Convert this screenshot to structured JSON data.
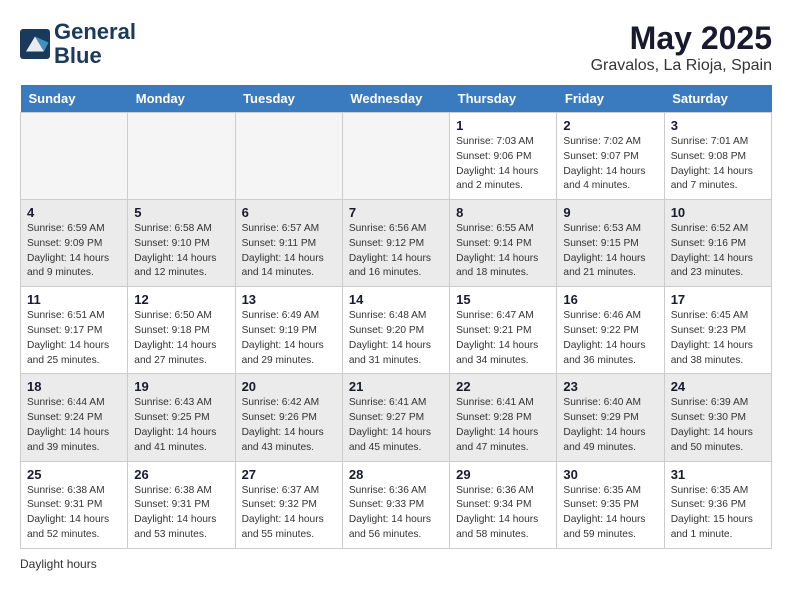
{
  "header": {
    "logo_line1": "General",
    "logo_line2": "Blue",
    "month": "May 2025",
    "location": "Gravalos, La Rioja, Spain"
  },
  "days_of_week": [
    "Sunday",
    "Monday",
    "Tuesday",
    "Wednesday",
    "Thursday",
    "Friday",
    "Saturday"
  ],
  "weeks": [
    [
      {
        "day": "",
        "empty": true
      },
      {
        "day": "",
        "empty": true
      },
      {
        "day": "",
        "empty": true
      },
      {
        "day": "",
        "empty": true
      },
      {
        "day": "1",
        "sunrise": "7:03 AM",
        "sunset": "9:06 PM",
        "daylight": "14 hours and 2 minutes."
      },
      {
        "day": "2",
        "sunrise": "7:02 AM",
        "sunset": "9:07 PM",
        "daylight": "14 hours and 4 minutes."
      },
      {
        "day": "3",
        "sunrise": "7:01 AM",
        "sunset": "9:08 PM",
        "daylight": "14 hours and 7 minutes."
      }
    ],
    [
      {
        "day": "4",
        "sunrise": "6:59 AM",
        "sunset": "9:09 PM",
        "daylight": "14 hours and 9 minutes."
      },
      {
        "day": "5",
        "sunrise": "6:58 AM",
        "sunset": "9:10 PM",
        "daylight": "14 hours and 12 minutes."
      },
      {
        "day": "6",
        "sunrise": "6:57 AM",
        "sunset": "9:11 PM",
        "daylight": "14 hours and 14 minutes."
      },
      {
        "day": "7",
        "sunrise": "6:56 AM",
        "sunset": "9:12 PM",
        "daylight": "14 hours and 16 minutes."
      },
      {
        "day": "8",
        "sunrise": "6:55 AM",
        "sunset": "9:14 PM",
        "daylight": "14 hours and 18 minutes."
      },
      {
        "day": "9",
        "sunrise": "6:53 AM",
        "sunset": "9:15 PM",
        "daylight": "14 hours and 21 minutes."
      },
      {
        "day": "10",
        "sunrise": "6:52 AM",
        "sunset": "9:16 PM",
        "daylight": "14 hours and 23 minutes."
      }
    ],
    [
      {
        "day": "11",
        "sunrise": "6:51 AM",
        "sunset": "9:17 PM",
        "daylight": "14 hours and 25 minutes."
      },
      {
        "day": "12",
        "sunrise": "6:50 AM",
        "sunset": "9:18 PM",
        "daylight": "14 hours and 27 minutes."
      },
      {
        "day": "13",
        "sunrise": "6:49 AM",
        "sunset": "9:19 PM",
        "daylight": "14 hours and 29 minutes."
      },
      {
        "day": "14",
        "sunrise": "6:48 AM",
        "sunset": "9:20 PM",
        "daylight": "14 hours and 31 minutes."
      },
      {
        "day": "15",
        "sunrise": "6:47 AM",
        "sunset": "9:21 PM",
        "daylight": "14 hours and 34 minutes."
      },
      {
        "day": "16",
        "sunrise": "6:46 AM",
        "sunset": "9:22 PM",
        "daylight": "14 hours and 36 minutes."
      },
      {
        "day": "17",
        "sunrise": "6:45 AM",
        "sunset": "9:23 PM",
        "daylight": "14 hours and 38 minutes."
      }
    ],
    [
      {
        "day": "18",
        "sunrise": "6:44 AM",
        "sunset": "9:24 PM",
        "daylight": "14 hours and 39 minutes."
      },
      {
        "day": "19",
        "sunrise": "6:43 AM",
        "sunset": "9:25 PM",
        "daylight": "14 hours and 41 minutes."
      },
      {
        "day": "20",
        "sunrise": "6:42 AM",
        "sunset": "9:26 PM",
        "daylight": "14 hours and 43 minutes."
      },
      {
        "day": "21",
        "sunrise": "6:41 AM",
        "sunset": "9:27 PM",
        "daylight": "14 hours and 45 minutes."
      },
      {
        "day": "22",
        "sunrise": "6:41 AM",
        "sunset": "9:28 PM",
        "daylight": "14 hours and 47 minutes."
      },
      {
        "day": "23",
        "sunrise": "6:40 AM",
        "sunset": "9:29 PM",
        "daylight": "14 hours and 49 minutes."
      },
      {
        "day": "24",
        "sunrise": "6:39 AM",
        "sunset": "9:30 PM",
        "daylight": "14 hours and 50 minutes."
      }
    ],
    [
      {
        "day": "25",
        "sunrise": "6:38 AM",
        "sunset": "9:31 PM",
        "daylight": "14 hours and 52 minutes."
      },
      {
        "day": "26",
        "sunrise": "6:38 AM",
        "sunset": "9:31 PM",
        "daylight": "14 hours and 53 minutes."
      },
      {
        "day": "27",
        "sunrise": "6:37 AM",
        "sunset": "9:32 PM",
        "daylight": "14 hours and 55 minutes."
      },
      {
        "day": "28",
        "sunrise": "6:36 AM",
        "sunset": "9:33 PM",
        "daylight": "14 hours and 56 minutes."
      },
      {
        "day": "29",
        "sunrise": "6:36 AM",
        "sunset": "9:34 PM",
        "daylight": "14 hours and 58 minutes."
      },
      {
        "day": "30",
        "sunrise": "6:35 AM",
        "sunset": "9:35 PM",
        "daylight": "14 hours and 59 minutes."
      },
      {
        "day": "31",
        "sunrise": "6:35 AM",
        "sunset": "9:36 PM",
        "daylight": "15 hours and 1 minute."
      }
    ]
  ],
  "footer": {
    "label": "Daylight hours"
  }
}
